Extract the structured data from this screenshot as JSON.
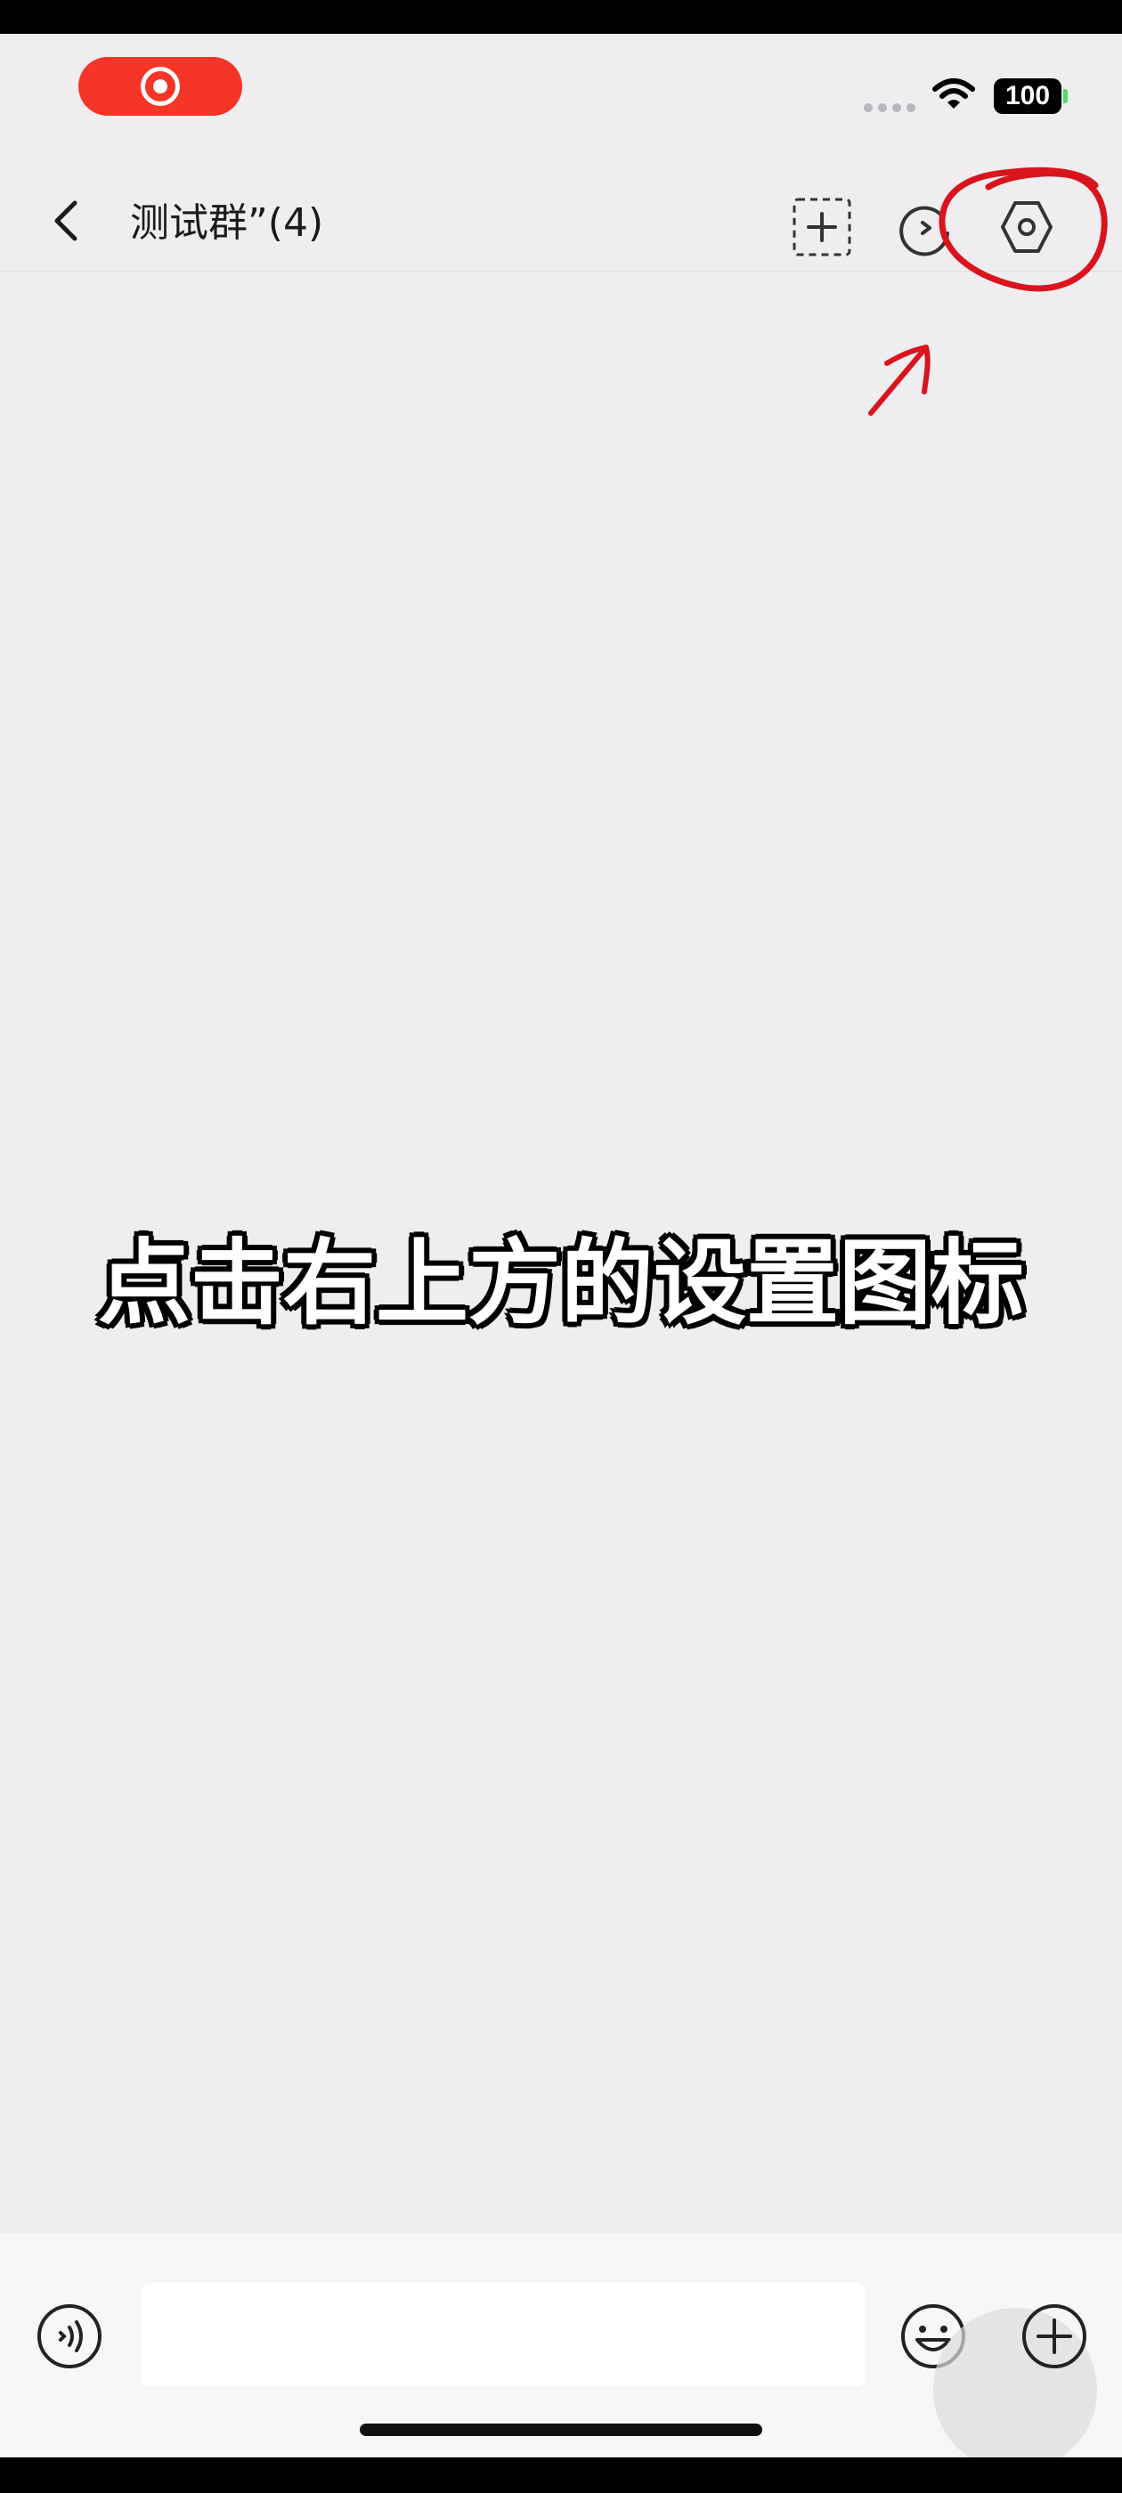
{
  "status_bar": {
    "battery_level": "100"
  },
  "nav": {
    "title": "测试群”(4)"
  },
  "caption": "点击右上方的设置图标",
  "input": {
    "placeholder": ""
  },
  "colors": {
    "recording": "#f43527",
    "annotation": "#d9141d",
    "background": "#efedf0"
  },
  "icons": [
    "record-icon",
    "wifi-icon",
    "back-icon",
    "add-member-icon",
    "history-icon",
    "settings-icon",
    "voice-icon",
    "emoji-icon",
    "plus-icon"
  ]
}
